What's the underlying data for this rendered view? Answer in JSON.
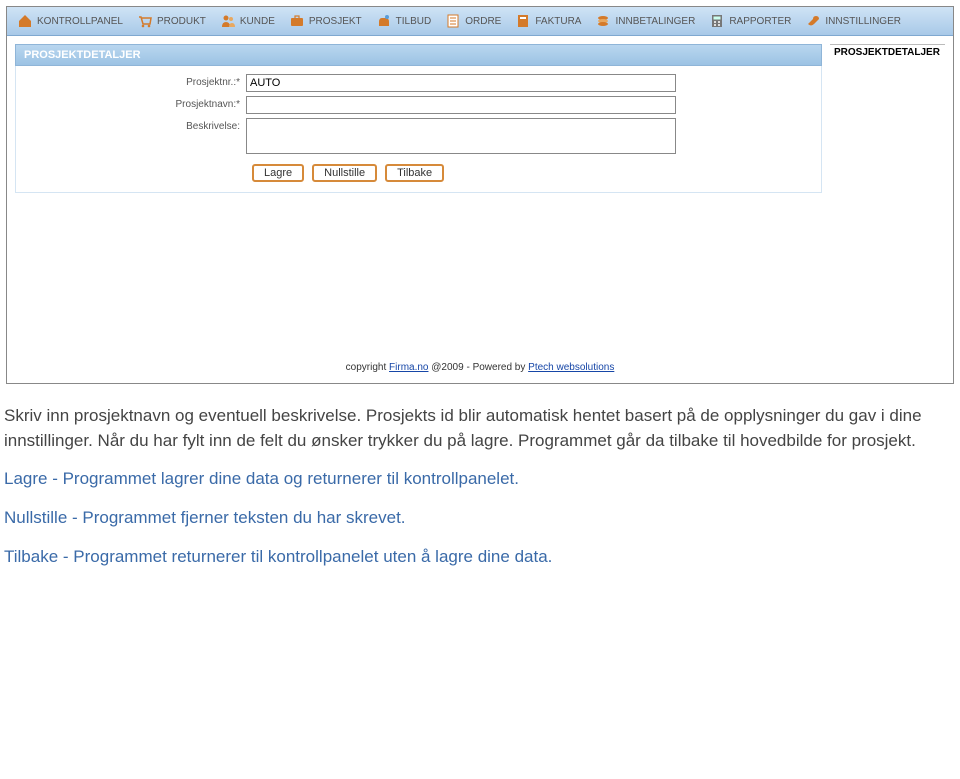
{
  "nav": {
    "items": [
      {
        "label": "KONTROLLPANEL",
        "icon": "home"
      },
      {
        "label": "PRODUKT",
        "icon": "cart"
      },
      {
        "label": "KUNDE",
        "icon": "people"
      },
      {
        "label": "PROSJEKT",
        "icon": "briefcase"
      },
      {
        "label": "TILBUD",
        "icon": "hand"
      },
      {
        "label": "ORDRE",
        "icon": "list"
      },
      {
        "label": "FAKTURA",
        "icon": "doc"
      },
      {
        "label": "INNBETALINGER",
        "icon": "stack"
      },
      {
        "label": "RAPPORTER",
        "icon": "calc"
      },
      {
        "label": "INNSTILLINGER",
        "icon": "wrench"
      }
    ]
  },
  "panel": {
    "title": "PROSJEKTDETALJER",
    "side_title": "PROSJEKTDETALJER"
  },
  "form": {
    "fields": {
      "prosjektnr": {
        "label": "Prosjektnr.:*",
        "value": "AUTO"
      },
      "prosjektnavn": {
        "label": "Prosjektnavn:*",
        "value": ""
      },
      "beskrivelse": {
        "label": "Beskrivelse:",
        "value": ""
      }
    },
    "buttons": {
      "lagre": "Lagre",
      "nullstille": "Nullstille",
      "tilbake": "Tilbake"
    }
  },
  "footer": {
    "copy1": "copyright ",
    "firma": "Firma.no",
    "at": " @2009",
    "sep": "    -    ",
    "powered": "Powered by ",
    "ptech": "Ptech websolutions"
  },
  "help": {
    "p1": "Skriv inn prosjektnavn og eventuell beskrivelse. Prosjekts id blir automatisk hentet basert på de opplysninger du gav i dine innstillinger. Når du har fylt inn de felt du ønsker trykker du på lagre. Programmet går da tilbake til hovedbilde for prosjekt.",
    "p2": "Lagre - Programmet lagrer dine data og returnerer til kontrollpanelet.",
    "p3": "Nullstille - Programmet fjerner teksten du har skrevet.",
    "p4": "Tilbake - Programmet returnerer til kontrollpanelet uten å lagre dine data."
  }
}
